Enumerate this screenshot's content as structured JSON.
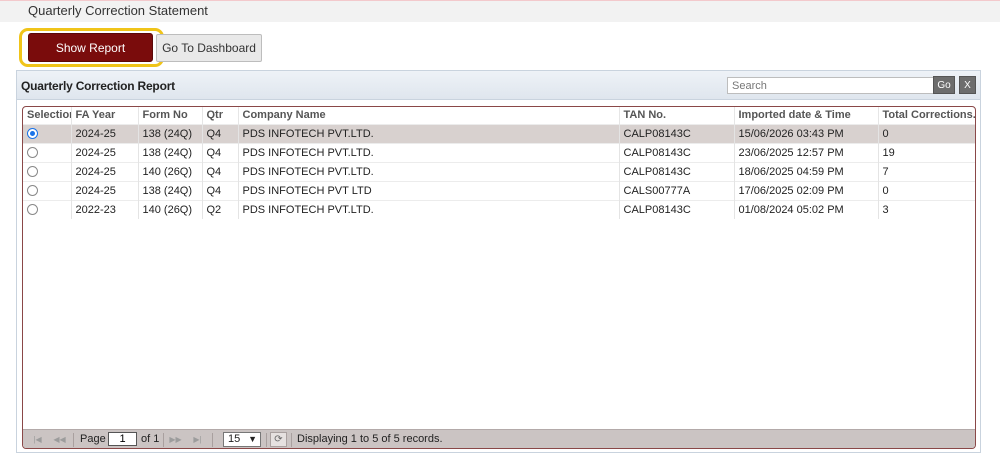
{
  "page": {
    "title": "Quarterly Correction Statement"
  },
  "toolbar": {
    "show_report_label": "Show Report",
    "dashboard_label": "Go To Dashboard"
  },
  "report": {
    "title": "Quarterly Correction Report",
    "search_placeholder": "Search",
    "go_label": "Go",
    "clear_label": "X"
  },
  "table": {
    "columns": [
      "Selection",
      "FA Year",
      "Form No",
      "Qtr",
      "Company Name",
      "TAN No.",
      "Imported date & Time",
      "Total Corrections."
    ],
    "rows": [
      {
        "selected": true,
        "fa_year": "2024-25",
        "form_no": "138 (24Q)",
        "qtr": "Q4",
        "company": "PDS INFOTECH PVT.LTD.",
        "tan": "CALP08143C",
        "imported": "15/06/2026 03:43 PM",
        "total": "0"
      },
      {
        "selected": false,
        "fa_year": "2024-25",
        "form_no": "138 (24Q)",
        "qtr": "Q4",
        "company": "PDS INFOTECH PVT.LTD.",
        "tan": "CALP08143C",
        "imported": "23/06/2025 12:57 PM",
        "total": "19"
      },
      {
        "selected": false,
        "fa_year": "2024-25",
        "form_no": "140 (26Q)",
        "qtr": "Q4",
        "company": "PDS INFOTECH PVT.LTD.",
        "tan": "CALP08143C",
        "imported": "18/06/2025 04:59 PM",
        "total": "7"
      },
      {
        "selected": false,
        "fa_year": "2024-25",
        "form_no": "138 (24Q)",
        "qtr": "Q4",
        "company": "PDS INFOTECH PVT LTD",
        "tan": "CALS00777A",
        "imported": "17/06/2025 02:09 PM",
        "total": "0"
      },
      {
        "selected": false,
        "fa_year": "2022-23",
        "form_no": "140 (26Q)",
        "qtr": "Q2",
        "company": "PDS INFOTECH PVT.LTD.",
        "tan": "CALP08143C",
        "imported": "01/08/2024 05:02 PM",
        "total": "3"
      }
    ]
  },
  "pager": {
    "page_label": "Page",
    "current_page": "1",
    "of_label": "of 1",
    "page_size": "15",
    "status": "Displaying 1 to 5 of 5 records."
  },
  "colors": {
    "accent": "#7a0c0c",
    "highlight": "#f0c419",
    "selected_row": "#d8d1cf"
  },
  "icons": [
    "first-page-icon",
    "prev-page-icon",
    "next-page-icon",
    "last-page-icon",
    "refresh-icon",
    "dropdown-arrow-icon"
  ]
}
